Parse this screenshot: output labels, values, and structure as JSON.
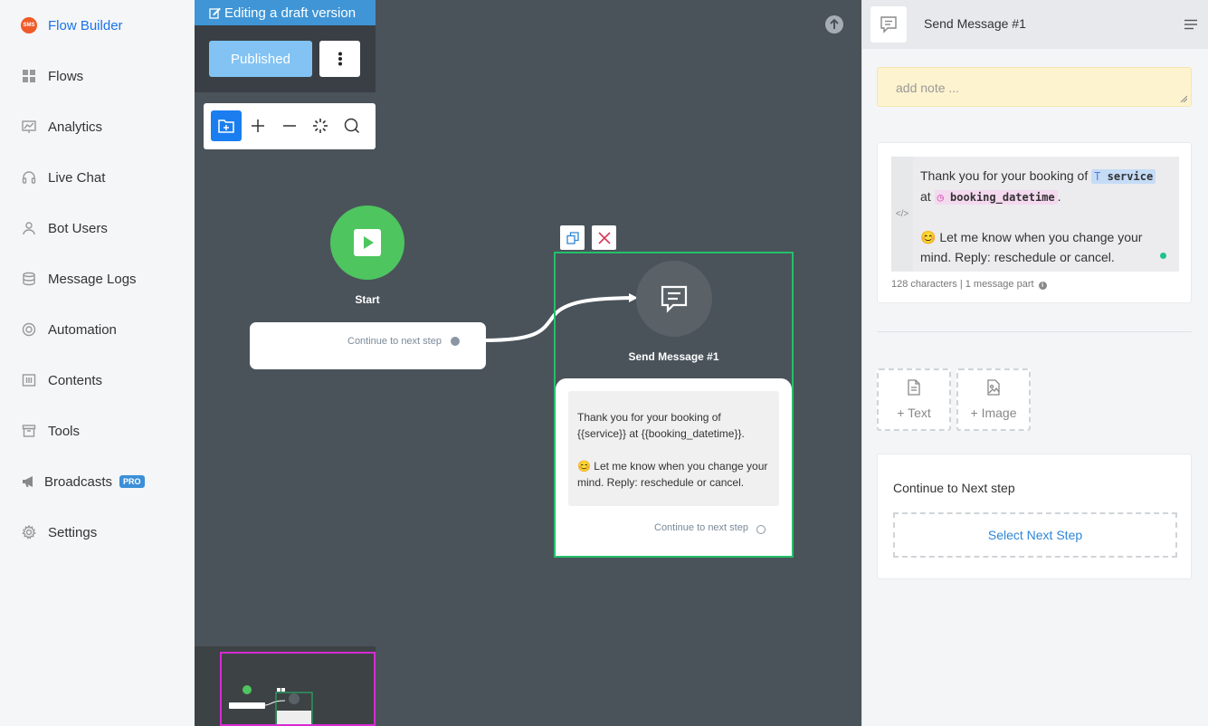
{
  "sidebar": {
    "items": [
      {
        "label": "Flow Builder",
        "icon": "sms-logo-icon"
      },
      {
        "label": "Flows",
        "icon": "grid-icon"
      },
      {
        "label": "Analytics",
        "icon": "chart-icon"
      },
      {
        "label": "Live Chat",
        "icon": "headset-icon"
      },
      {
        "label": "Bot Users",
        "icon": "user-icon"
      },
      {
        "label": "Message Logs",
        "icon": "database-icon"
      },
      {
        "label": "Automation",
        "icon": "lifebuoy-icon"
      },
      {
        "label": "Contents",
        "icon": "columns-icon"
      },
      {
        "label": "Tools",
        "icon": "archive-icon"
      },
      {
        "label": "Broadcasts",
        "icon": "megaphone-icon",
        "badge": "PRO"
      },
      {
        "label": "Settings",
        "icon": "gear-icon"
      }
    ],
    "logo_text": "SMS",
    "active_color": "#1a73e8"
  },
  "canvas": {
    "draft_banner": "Editing a draft version",
    "published_label": "Published",
    "start_node": {
      "label": "Start",
      "continue": "Continue to next step"
    },
    "message_node": {
      "title": "Send Message #1",
      "line1": "Thank you for your booking of",
      "line2": "{{service}} at {{booking_datetime}}.",
      "line3": "😊 Let me know when you change your",
      "line4": "mind. Reply: reschedule or cancel.",
      "continue": "Continue to next step"
    },
    "colors": {
      "start": "#4ec55f",
      "selected_border": "#24c06b",
      "minimap_frame": "#d62bd3"
    }
  },
  "panel": {
    "title": "Send Message #1",
    "note_placeholder": "add note ...",
    "message": {
      "prefix": "Thank you for your booking of",
      "var_service": "service",
      "at": "at",
      "var_datetime": "booking_datetime",
      "period": ".",
      "line2": "😊 Let me know when you change your mind. Reply: reschedule or cancel."
    },
    "char_count": "128 characters | 1 message part",
    "add_text": "+ Text",
    "add_image": "+ Image",
    "continue_label": "Continue to Next step",
    "select_next": "Select Next Step"
  }
}
